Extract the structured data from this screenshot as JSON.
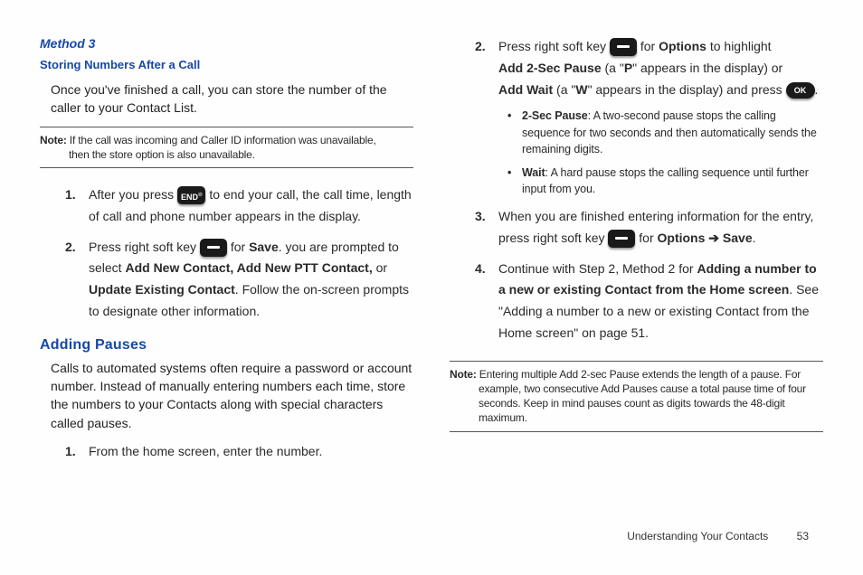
{
  "left": {
    "method_title": "Method 3",
    "subsection": "Storing Numbers After a Call",
    "intro": "Once you've finished a call, you can store the number of the caller to your Contact List.",
    "note_label": "Note:",
    "note_line1_rest": " If the call was incoming and Caller ID information was unavailable,",
    "note_line2": "then the store option is also unavailable.",
    "step1_a": "After you press ",
    "step1_key": "END",
    "step1_b": " to end your call, the call time, length of call and phone number appears in the display.",
    "step2_a": "Press right soft key ",
    "step2_b": " for ",
    "step2_save": "Save",
    "step2_c": ". you are prompted to select ",
    "step2_opts": "Add New Contact, Add New PTT Contact,",
    "step2_or": " or ",
    "step2_update": "Update Existing Contact",
    "step2_d": ". Follow the on-screen prompts to designate other information.",
    "heading": "Adding Pauses",
    "para": "Calls to automated systems often require a password or account number. Instead of manually entering numbers each time, store the numbers to your Contacts along with special characters called pauses.",
    "step_b1": "From the home screen, enter the number."
  },
  "right": {
    "s2_a": "Press right soft key ",
    "s2_b": " for ",
    "s2_opt": "Options",
    "s2_c": " to highlight ",
    "s2_add2": "Add 2-Sec Pause",
    "s2_d": " (a \"",
    "s2_p": "P",
    "s2_e": "\" appears in the display) or ",
    "s2_addw": "Add Wait",
    "s2_f": " (a \"",
    "s2_w": "W",
    "s2_g": "\" appears in the display) and press ",
    "s2_ok": "OK",
    "s2_h": ".",
    "b1_label": "2-Sec Pause",
    "b1_text": ": A two-second pause stops the calling sequence for two seconds and then automatically sends the remaining digits.",
    "b2_label": "Wait",
    "b2_text": ": A hard pause stops the calling sequence until further input from you.",
    "s3_a": "When you are finished entering information for the entry, press right soft key ",
    "s3_b": " for ",
    "s3_opt": "Options",
    "s3_arrow": " ➔ ",
    "s3_save": "Save",
    "s3_c": ".",
    "s4_a": "Continue with Step 2, Method 2 for ",
    "s4_bold": "Adding a number to a new or existing Contact from the Home screen",
    "s4_b": ". See \"Adding a number to a new or existing Contact from the Home screen\" on page 51.",
    "note_label": "Note:",
    "note_rest": " Entering multiple Add 2-sec Pause extends the length of a pause. For",
    "note_l2": "example, two consecutive Add Pauses cause a total pause time of four",
    "note_l3": "seconds. Keep in mind pauses count as digits towards the 48-digit",
    "note_l4": "maximum."
  },
  "footer": {
    "section": "Understanding Your Contacts",
    "page": "53"
  }
}
